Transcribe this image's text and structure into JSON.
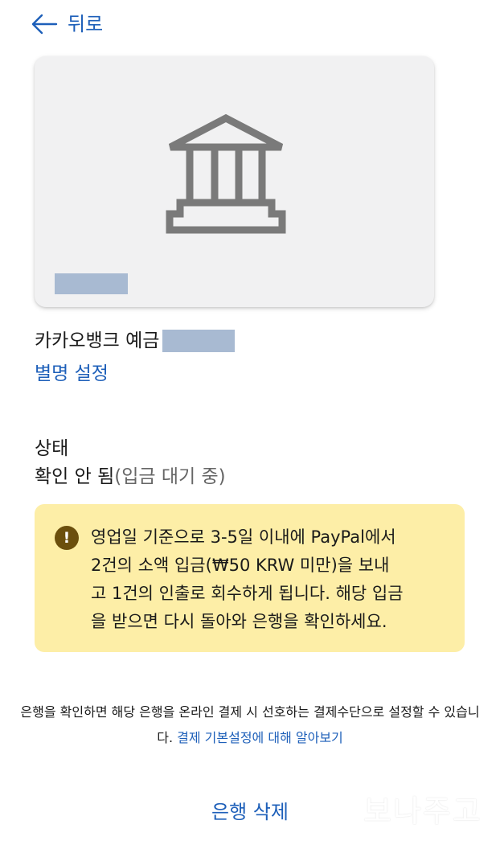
{
  "header": {
    "back_label": "뒤로"
  },
  "bank": {
    "name": "카카오뱅크 예금",
    "nickname_link": "별명 설정"
  },
  "status": {
    "label": "상태",
    "value_main": "확인 안 됨",
    "value_sub": "(입금 대기 중)"
  },
  "notice": {
    "icon": "!",
    "text": "영업일 기준으로 3-5일 이내에 PayPal에서\n2건의 소액 입금(₩50 KRW 미만)을 보내\n고 1건의 인출로 회수하게 됩니다. 해당 입금\n을 받으면 다시 돌아와 은행을 확인하세요."
  },
  "footer": {
    "text": "은행을 확인하면 해당 은행을 온라인 결제 시 선호하는 결제수단으로 설정할 수 있습니다. ",
    "link": "결제 기본설정에 대해 알아보기"
  },
  "actions": {
    "delete_label": "은행 삭제"
  },
  "watermark": "보나주고",
  "colors": {
    "link": "#1d5fb9",
    "notice_background": "#fdeea7",
    "notice_icon": "#6b4f0d",
    "redaction": "#a8bad2",
    "card_background": "#f1f1f2"
  }
}
